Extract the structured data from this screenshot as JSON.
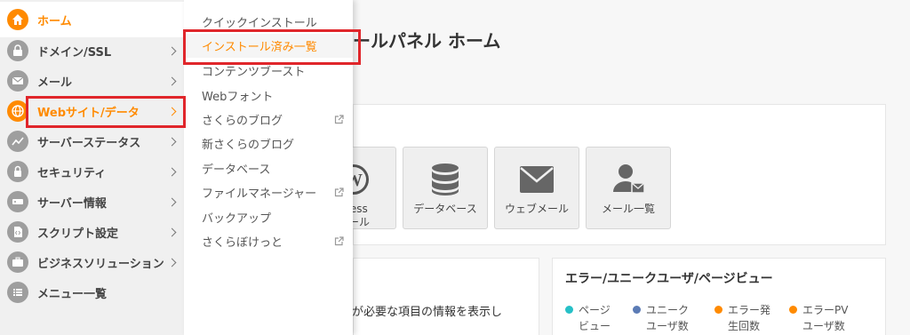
{
  "sidebar": {
    "items": [
      {
        "label": "ホーム",
        "icon": "home-icon"
      },
      {
        "label": "ドメイン/SSL",
        "icon": "domain-icon"
      },
      {
        "label": "メール",
        "icon": "mail-icon"
      },
      {
        "label": "Webサイト/データ",
        "icon": "globe-icon"
      },
      {
        "label": "サーバーステータス",
        "icon": "chart-icon"
      },
      {
        "label": "セキュリティ",
        "icon": "lock-icon"
      },
      {
        "label": "サーバー情報",
        "icon": "server-icon"
      },
      {
        "label": "スクリプト設定",
        "icon": "script-icon"
      },
      {
        "label": "ビジネスソリューション",
        "icon": "briefcase-icon"
      },
      {
        "label": "メニュー一覧",
        "icon": "list-icon"
      }
    ]
  },
  "submenu": {
    "items": [
      {
        "label": "クイックインストール",
        "external": false
      },
      {
        "label": "インストール済み一覧",
        "external": false
      },
      {
        "label": "コンテンツブースト",
        "external": false
      },
      {
        "label": "Webフォント",
        "external": false
      },
      {
        "label": "さくらのブログ",
        "external": true
      },
      {
        "label": "新さくらのブログ",
        "external": false
      },
      {
        "label": "データベース",
        "external": false
      },
      {
        "label": "ファイルマネージャー",
        "external": true
      },
      {
        "label": "バックアップ",
        "external": false
      },
      {
        "label": "さくらぼけっと",
        "external": true
      }
    ]
  },
  "main": {
    "title": "ールパネル ホーム",
    "tiles": [
      {
        "line1": "Press",
        "line2": "トール",
        "icon": "wordpress-icon"
      },
      {
        "line1": "データベース",
        "line2": "",
        "icon": "database-icon"
      },
      {
        "line1": "ウェブメール",
        "line2": "",
        "icon": "envelope-icon"
      },
      {
        "line1": "メール一覧",
        "line2": "",
        "icon": "user-mail-icon"
      }
    ],
    "notice_text": "意が必要な項目の情報を表示し",
    "stats": {
      "title": "エラー/ユニークユーザ/ページビュー",
      "legend": [
        {
          "line1": "ページ",
          "line2": "ビュー",
          "color": "#26c0c7"
        },
        {
          "line1": "ユニーク",
          "line2": "ユーザ数",
          "color": "#5b7bb5"
        },
        {
          "line1": "エラー発",
          "line2": "生回数",
          "color": "#ff8a00"
        },
        {
          "line1": "エラーPV",
          "line2": "ユーザ数",
          "color": "#ff8a00"
        }
      ]
    }
  },
  "colors": {
    "accent": "#ff8a00",
    "highlight": "#e0262b"
  }
}
